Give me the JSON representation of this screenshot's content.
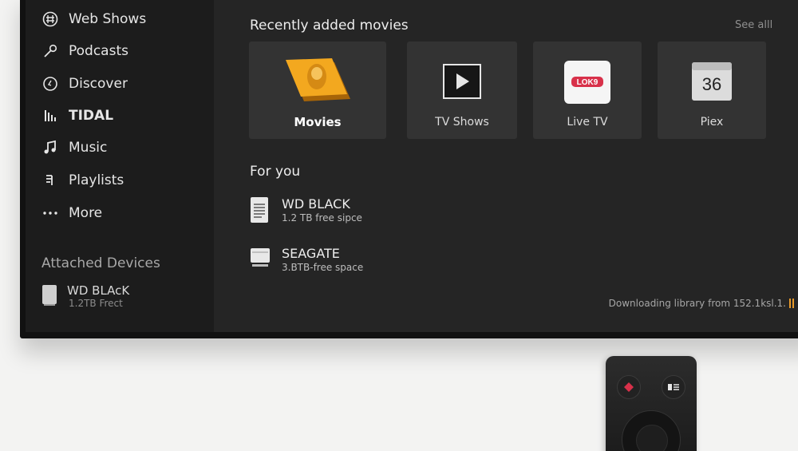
{
  "sidebar": {
    "items": [
      {
        "label": "Web Shows",
        "icon": "hash-circle-icon"
      },
      {
        "label": "Podcasts",
        "icon": "wrench-icon"
      },
      {
        "label": "Discover",
        "icon": "compass-icon"
      },
      {
        "label": "TIDAL",
        "icon": "tidal-bars-icon"
      },
      {
        "label": "Music",
        "icon": "music-note-icon"
      },
      {
        "label": "Playlists",
        "icon": "playlist-icon"
      },
      {
        "label": "More",
        "icon": "more-dots-icon"
      }
    ],
    "attached_label": "Attached Devices",
    "attached_device": {
      "name": "WD BLAcK",
      "detail": "1.2TB Frect"
    }
  },
  "main": {
    "recent_title": "Recently added movies",
    "see_all": "See alll",
    "tiles": [
      {
        "label": "Movies"
      },
      {
        "label": "TV Shows"
      },
      {
        "label": "Live TV",
        "logo_text": "LOK9"
      },
      {
        "label": "Piex",
        "icon_text": "36"
      }
    ],
    "for_you_title": "For you",
    "devices": [
      {
        "name": "WD BLACK",
        "detail": "1.2 TB free sipce"
      },
      {
        "name": "SEAGATE",
        "detail": "3.BTB-free space"
      }
    ],
    "status": "Downloading library from 152.1ksl.1."
  },
  "colors": {
    "accent": "#e89a2a",
    "movies_tile": "#f0a020",
    "live_tv_red": "#d8314a"
  }
}
